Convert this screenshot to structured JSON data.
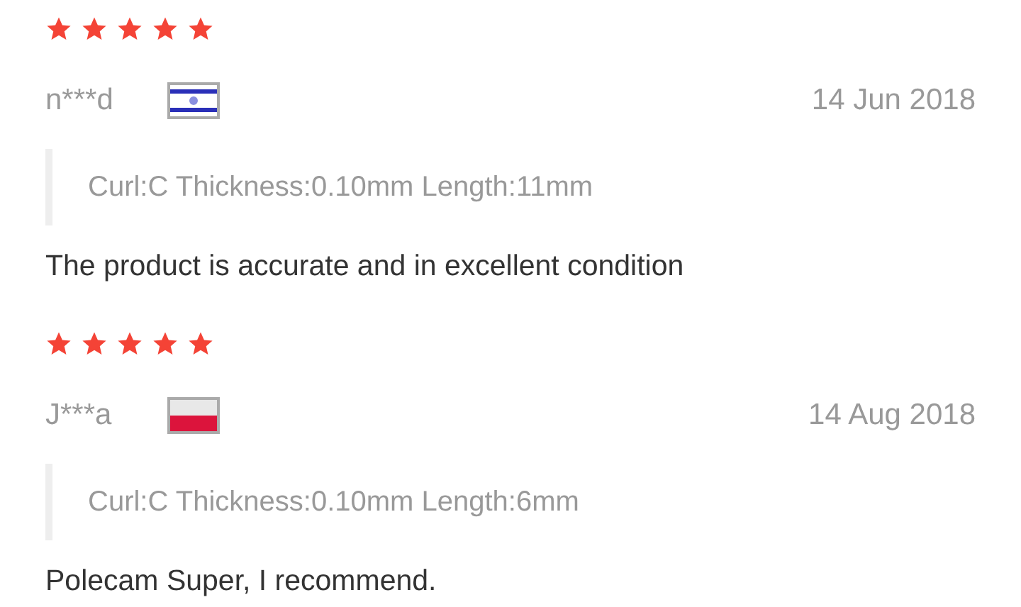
{
  "reviews": [
    {
      "stars": 5,
      "user": "n***d",
      "flag": {
        "kind": "il"
      },
      "date": "14 Jun 2018",
      "sku": "Curl:C Thickness:0.10mm Length:11mm",
      "text": "The product is accurate and in excellent condition"
    },
    {
      "stars": 5,
      "user": "J***a",
      "flag": {
        "kind": "pl"
      },
      "date": "14 Aug 2018",
      "sku": "Curl:C Thickness:0.10mm Length:6mm",
      "text": "Polecam Super, I recommend."
    }
  ]
}
